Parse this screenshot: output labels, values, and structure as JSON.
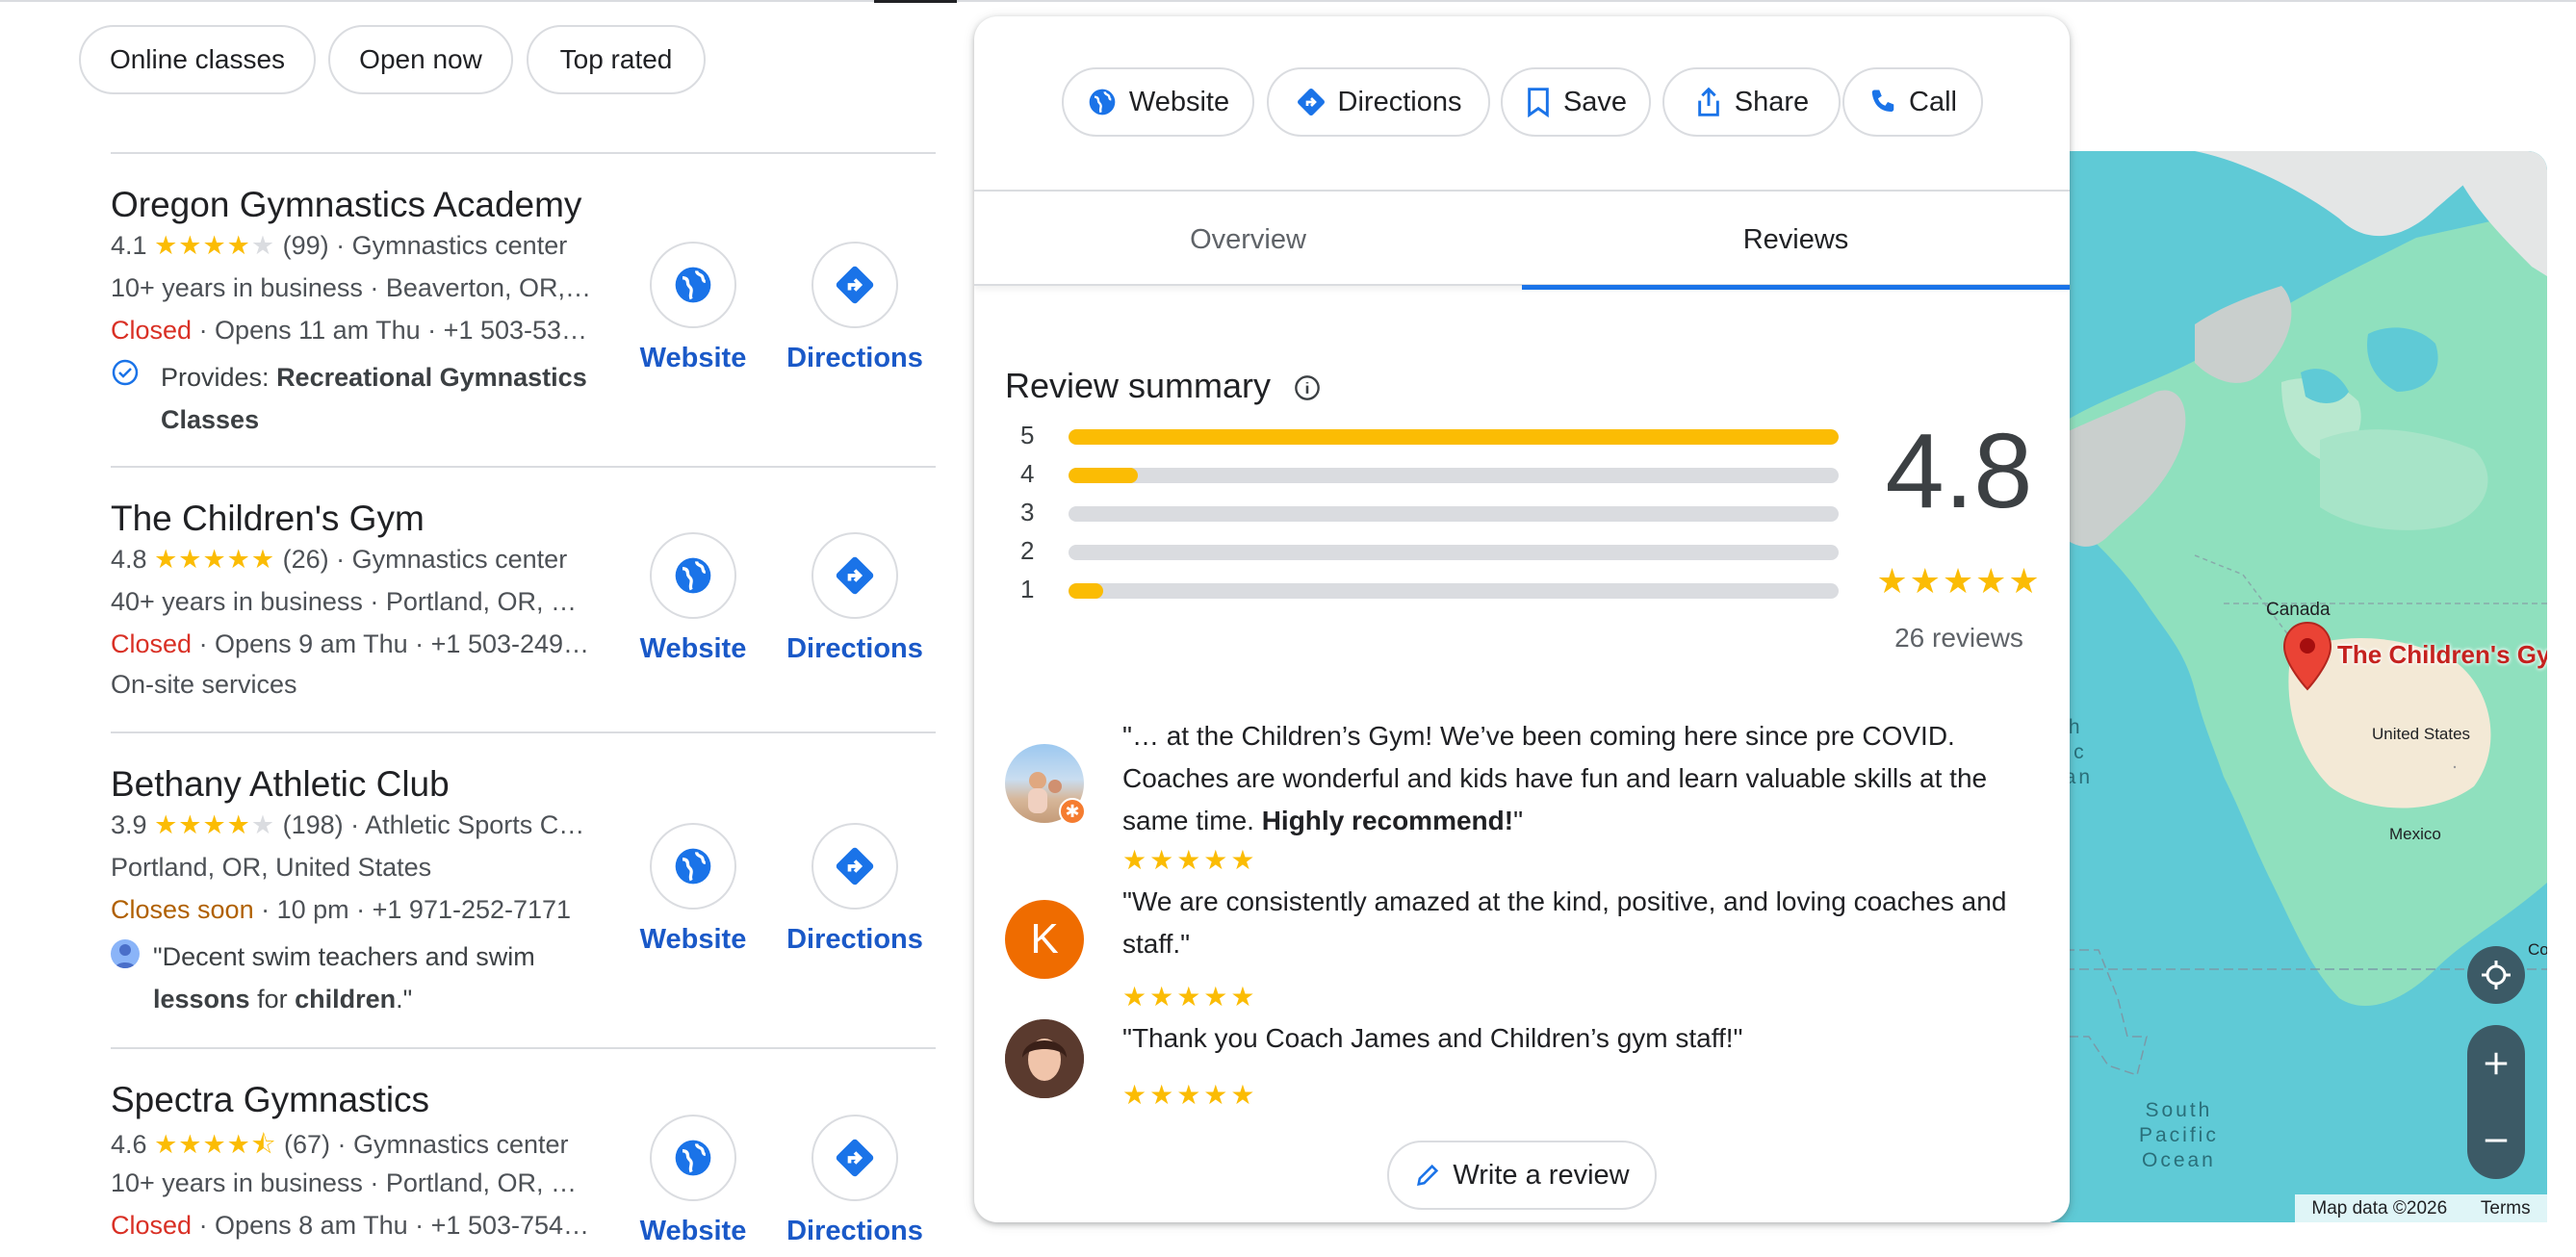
{
  "filters": [
    "Online classes",
    "Open now",
    "Top rated"
  ],
  "results": [
    {
      "name": "Oregon Gymnastics Academy",
      "rating": "4.1",
      "stars": "★★★★",
      "stars_empty": "★",
      "reviews": "(99)",
      "category": "Gymnastics center",
      "line2": "10+ years in business · Beaverton, OR,…",
      "status": "Closed",
      "hours": "· Opens 11 am Thu · +1 503-53…",
      "extra_prefix": "Provides: ",
      "extra_bold": "Recreational Gymnastics",
      "extra_bold2": "Classes"
    },
    {
      "name": "The Children's Gym",
      "rating": "4.8",
      "stars": "★★★★★",
      "stars_empty": "",
      "reviews": "(26)",
      "category": "Gymnastics center",
      "line2": "40+ years in business · Portland, OR, …",
      "status": "Closed",
      "hours": "· Opens 9 am Thu · +1 503-249…",
      "extra": "On-site services"
    },
    {
      "name": "Bethany Athletic Club",
      "rating": "3.9",
      "stars": "★★★★",
      "stars_empty": "★",
      "reviews": "(198)",
      "category": "Athletic Sports C…",
      "line2": "Portland, OR, United States",
      "status": "Closes soon",
      "hours": "· 10 pm · +1 971-252-7171",
      "quote_1": "\"Decent swim teachers and swim",
      "quote_b1": "lessons",
      "quote_2": " for ",
      "quote_b2": "children",
      "quote_3": ".\""
    },
    {
      "name": "Spectra Gymnastics",
      "rating": "4.6",
      "stars": "★★★★⯪",
      "stars_empty": "",
      "reviews": "(67)",
      "category": "Gymnastics center",
      "line2": "10+ years in business · Portland, OR, …",
      "status": "Closed",
      "hours": "· Opens 8 am Thu · +1 503-754…"
    }
  ],
  "result_actions": {
    "website": "Website",
    "directions": "Directions"
  },
  "panel": {
    "actions": {
      "website": "Website",
      "directions": "Directions",
      "save": "Save",
      "share": "Share",
      "call": "Call"
    },
    "tabs": {
      "overview": "Overview",
      "reviews": "Reviews"
    },
    "summary_title": "Review summary",
    "distribution": [
      {
        "stars": "5",
        "fraction": 1.0
      },
      {
        "stars": "4",
        "fraction": 0.09
      },
      {
        "stars": "3",
        "fraction": 0.0
      },
      {
        "stars": "2",
        "fraction": 0.0
      },
      {
        "stars": "1",
        "fraction": 0.045
      }
    ],
    "score": "4.8",
    "score_stars": "★★★★★",
    "review_count": "26 reviews",
    "reviews": [
      {
        "text_1": "\"… at the Children’s Gym! We’ve been coming here since pre COVID. Coaches are wonderful and kids have fun and learn valuable skills at the same time. ",
        "text_bold": "Highly recommend!",
        "text_2": "\"",
        "stars": "★★★★★"
      },
      {
        "initial": "K",
        "text_1": "\"We are consistently amazed at the kind, positive, and loving coaches and staff.\"",
        "stars": "★★★★★"
      },
      {
        "text_1": "\"Thank you Coach James and Children’s gym staff!\"",
        "stars": "★★★★★"
      }
    ],
    "write_review": "Write a review"
  },
  "map": {
    "pin_label": "The Children's Gym",
    "labels": {
      "canada": "Canada",
      "us": "United States",
      "mexico": "Mexico",
      "north_pacific": "rth\nific\nean",
      "south_pacific": "South\nPacific\nOcean",
      "co": "Co"
    },
    "footer_data": "Map data ©2026",
    "footer_terms": "Terms"
  },
  "colors": {
    "accent": "#1a73e8",
    "star": "#fbbc04",
    "closed": "#d93025",
    "closes_soon": "#b06000",
    "link": "#1a59c8"
  }
}
